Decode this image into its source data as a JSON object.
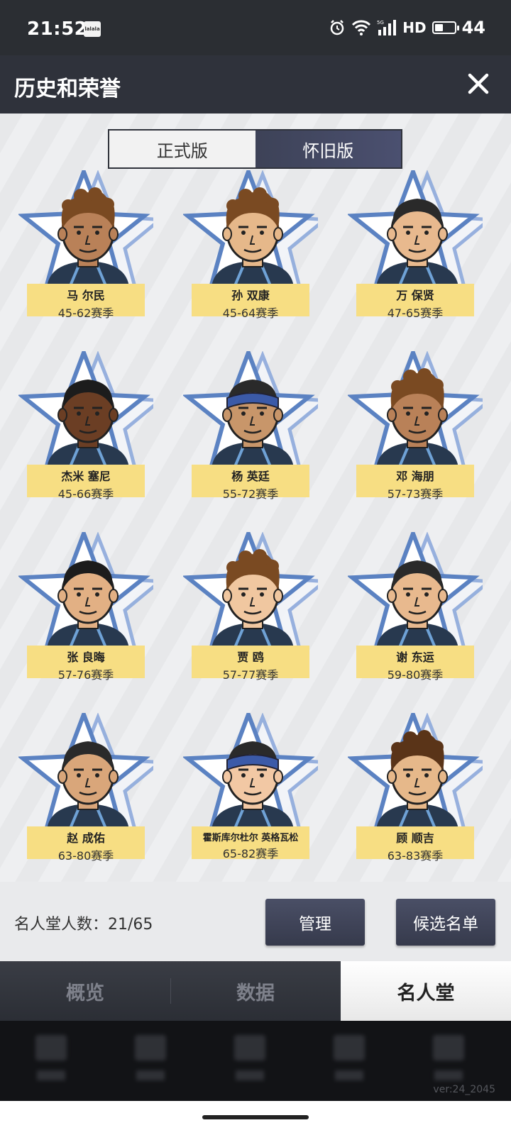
{
  "status_bar": {
    "time": "21:52",
    "app_icon_text": "lalala",
    "network": "HD",
    "battery": "44",
    "battery_fraction": 0.44
  },
  "header": {
    "title": "历史和荣誉"
  },
  "toggle": {
    "options": [
      "正式版",
      "怀旧版"
    ],
    "selected": "怀旧版"
  },
  "players": [
    {
      "name": "马 尔民",
      "seasons": "45-62赛季",
      "skin": "#b98158",
      "hair": "curly",
      "hair_color": "#7a4a22",
      "headband": false
    },
    {
      "name": "孙 双康",
      "seasons": "45-64赛季",
      "skin": "#e6b88a",
      "hair": "curly",
      "hair_color": "#7a4a22",
      "headband": false
    },
    {
      "name": "万 保贤",
      "seasons": "47-65赛季",
      "skin": "#e8b98e",
      "hair": "short",
      "hair_color": "#2a2a2a",
      "headband": false
    },
    {
      "name": "杰米 塞尼",
      "seasons": "45-66赛季",
      "skin": "#6b3e24",
      "hair": "short",
      "hair_color": "#1c1c1c",
      "headband": false
    },
    {
      "name": "杨 英廷",
      "seasons": "55-72赛季",
      "skin": "#c8966a",
      "hair": "short",
      "hair_color": "#2a2a2a",
      "headband": true
    },
    {
      "name": "邓 海朋",
      "seasons": "57-73赛季",
      "skin": "#b98158",
      "hair": "curly",
      "hair_color": "#7a4a22",
      "headband": false
    },
    {
      "name": "张 良晦",
      "seasons": "57-76赛季",
      "skin": "#e2b084",
      "hair": "short",
      "hair_color": "#1c1c1c",
      "headband": false
    },
    {
      "name": "贾 鸥",
      "seasons": "57-77赛季",
      "skin": "#f0c7a0",
      "hair": "curly",
      "hair_color": "#7a4a22",
      "headband": false
    },
    {
      "name": "谢 东运",
      "seasons": "59-80赛季",
      "skin": "#e8b98e",
      "hair": "short",
      "hair_color": "#2a2a2a",
      "headband": false
    },
    {
      "name": "赵 成佑",
      "seasons": "63-80赛季",
      "skin": "#d9a67a",
      "hair": "short",
      "hair_color": "#2a2a2a",
      "headband": false
    },
    {
      "name": "霍斯库尔杜尔 英格瓦松",
      "seasons": "65-82赛季",
      "skin": "#f2c8a4",
      "hair": "short",
      "hair_color": "#2a2a2a",
      "headband": true
    },
    {
      "name": "顾 顺吉",
      "seasons": "63-83赛季",
      "skin": "#e6b88a",
      "hair": "curly",
      "hair_color": "#5a3418",
      "headband": false
    }
  ],
  "footer": {
    "hof_count_label": "名人堂人数：21/65",
    "manage_label": "管理",
    "candidates_label": "候选名单"
  },
  "tabs": [
    {
      "label": "概览"
    },
    {
      "label": "数据"
    },
    {
      "label": "名人堂"
    }
  ],
  "active_tab": "名人堂",
  "version": "ver:24_2045",
  "colors": {
    "header_bg": "#2f323b",
    "label_bg": "#f7de83",
    "star_stroke": "#5b82c2",
    "jersey": "#28394f"
  }
}
